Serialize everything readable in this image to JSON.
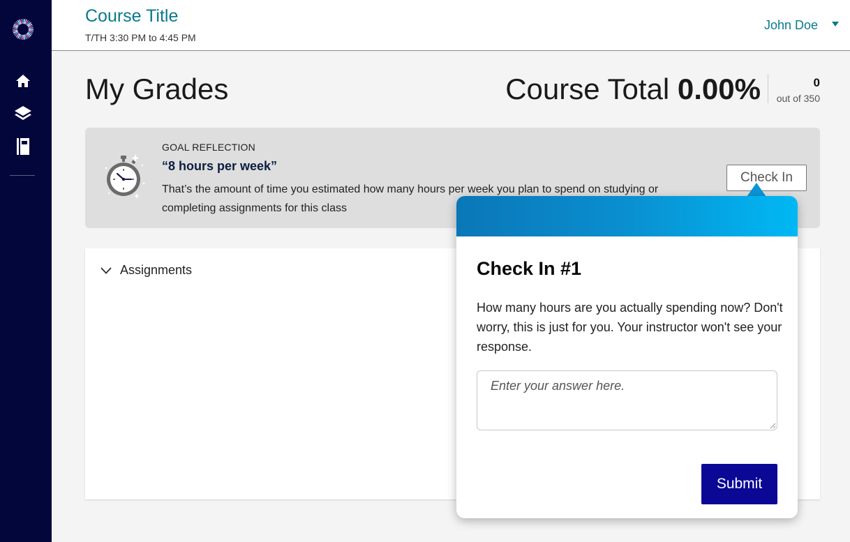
{
  "app": {
    "logo_icon": "sunburst-logo-icon"
  },
  "sidebar": {
    "items": [
      {
        "icon": "home-icon"
      },
      {
        "icon": "layers-icon"
      },
      {
        "icon": "notebook-icon"
      }
    ]
  },
  "header": {
    "course_title": "Course Title",
    "course_time": "T/TH 3:30 PM to 4:45 PM",
    "user_name": "John Doe"
  },
  "grades": {
    "page_title": "My Grades",
    "course_total_label": "Course Total",
    "course_total_value": "0.00%",
    "points": "0",
    "out_of": "out of 350"
  },
  "goal": {
    "label": "GOAL REFLECTION",
    "quote": "“8 hours per week”",
    "description": "That’s the amount of time you estimated how many hours per week you plan to spend on studying or completing assignments for this class",
    "check_in_label": "Check In"
  },
  "assignments": {
    "label": "Assignments"
  },
  "popover": {
    "title": "Check In #1",
    "text": "How many hours are you actually spending now? Don't worry, this is just for you. Your instructor won't see your response.",
    "input_placeholder": "Enter your answer here.",
    "input_value": "",
    "submit_label": "Submit"
  },
  "colors": {
    "sidebar_bg": "#03063a",
    "accent_teal": "#0a7a8c",
    "submit_bg": "#0c0896",
    "popover_gradient_start": "#0a77b8",
    "popover_gradient_end": "#00b8f4"
  }
}
